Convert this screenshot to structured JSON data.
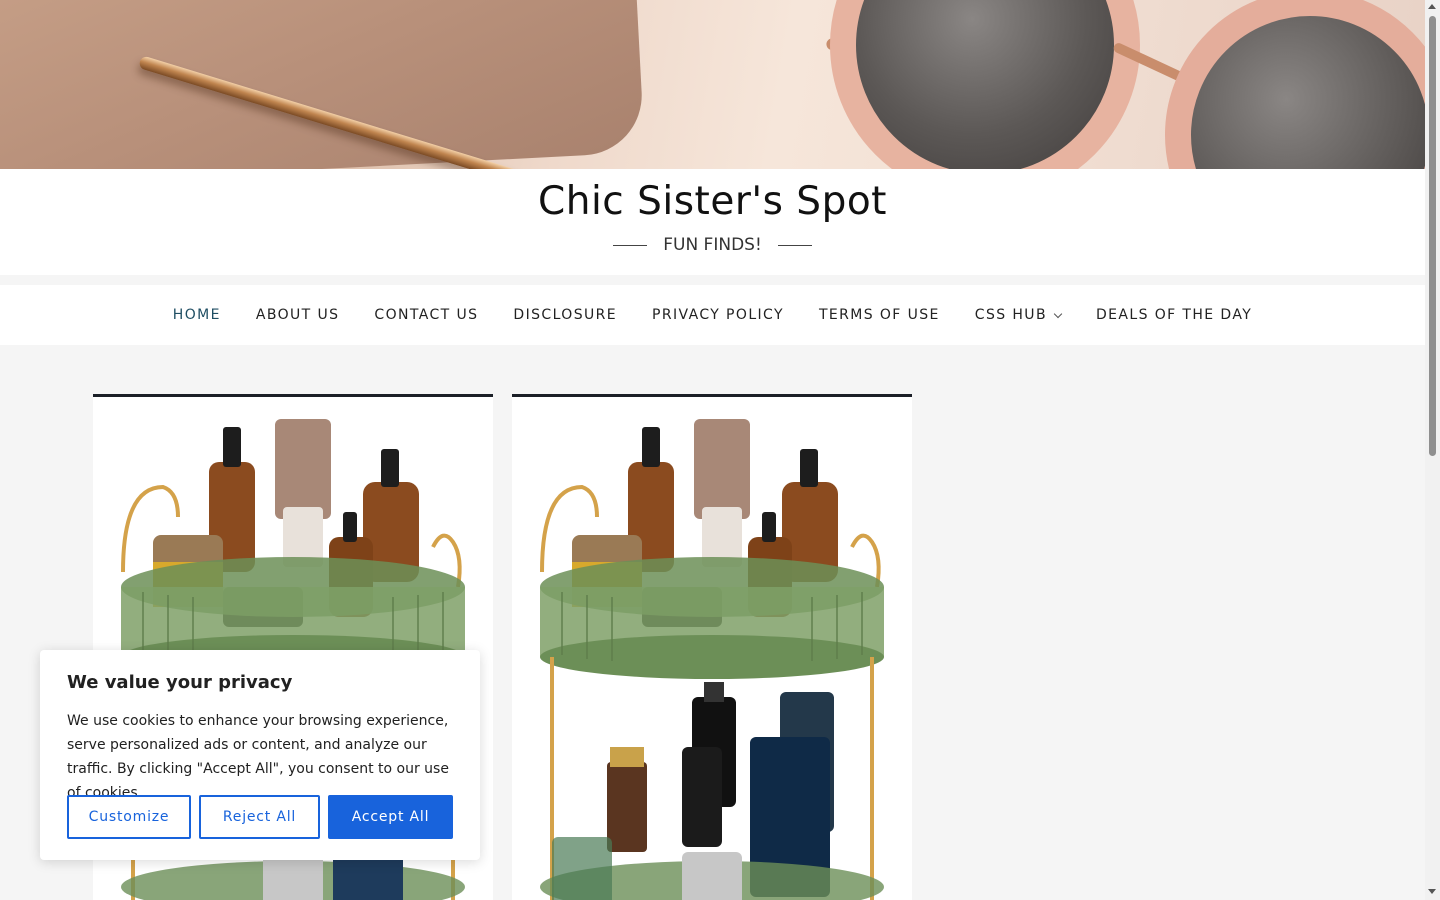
{
  "site": {
    "title": "Chic Sister's Spot",
    "tagline": "FUN FINDS!"
  },
  "nav": {
    "items": [
      {
        "label": "HOME",
        "active": true
      },
      {
        "label": "ABOUT US"
      },
      {
        "label": "CONTACT US"
      },
      {
        "label": "DISCLOSURE"
      },
      {
        "label": "PRIVACY POLICY"
      },
      {
        "label": "TERMS OF USE"
      },
      {
        "label": "CSS HUB",
        "has_dropdown": true
      },
      {
        "label": "DEALS OF THE DAY"
      }
    ]
  },
  "cookie": {
    "title": "We value your privacy",
    "text": "We use cookies to enhance your browsing experience, serve personalized ads or content, and analyze our traffic. By clicking \"Accept All\", you consent to our use of cookies.",
    "customize": "Customize",
    "reject": "Reject All",
    "accept": "Accept All"
  },
  "colors": {
    "accent": "#1863dc",
    "nav_active": "#1f4e63",
    "card_top_border": "#1b1f27"
  }
}
